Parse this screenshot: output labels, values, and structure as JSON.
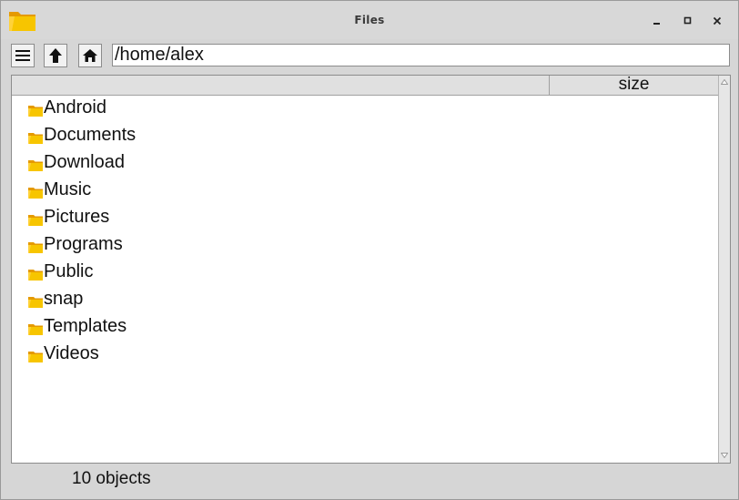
{
  "window": {
    "title": "Files",
    "app_icon": "folder-icon",
    "controls": [
      "minimize-icon",
      "maximize-icon",
      "close-icon"
    ]
  },
  "toolbar": {
    "menu_icon": "hamburger-icon",
    "up_icon": "arrow-up-icon",
    "home_icon": "home-icon",
    "path_value": "/home/alex"
  },
  "list": {
    "columns": {
      "name_header": "",
      "size_header": "size"
    },
    "items": [
      {
        "name": "Android",
        "icon": "folder-icon"
      },
      {
        "name": "Documents",
        "icon": "folder-icon"
      },
      {
        "name": "Download",
        "icon": "folder-icon"
      },
      {
        "name": "Music",
        "icon": "folder-icon"
      },
      {
        "name": "Pictures",
        "icon": "folder-icon"
      },
      {
        "name": "Programs",
        "icon": "folder-icon"
      },
      {
        "name": "Public",
        "icon": "folder-icon"
      },
      {
        "name": "snap",
        "icon": "folder-icon"
      },
      {
        "name": "Templates",
        "icon": "folder-icon"
      },
      {
        "name": "Videos",
        "icon": "folder-icon"
      }
    ]
  },
  "status": {
    "text": "10 objects"
  },
  "colors": {
    "folder": "#f7c500",
    "folder_dark": "#e59a00",
    "chrome": "#d6d6d6"
  }
}
